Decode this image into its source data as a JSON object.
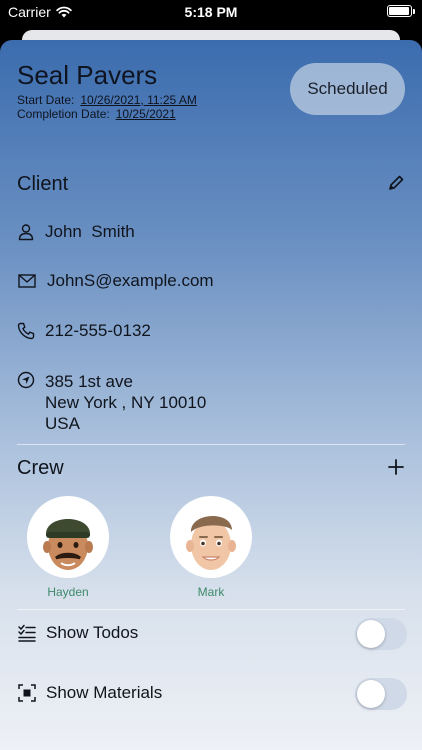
{
  "status_bar": {
    "carrier": "Carrier",
    "time": "5:18 PM"
  },
  "job": {
    "title": "Seal Pavers",
    "start_label": "Start Date:",
    "start_value": "10/26/2021, 11:25 AM",
    "completion_label": "Completion Date:",
    "completion_value": "10/25/2021",
    "status": "Scheduled"
  },
  "client": {
    "section_title": "Client",
    "name": "John  Smith",
    "email": "JohnS@example.com",
    "phone": "212-555-0132",
    "address_line1": "385 1st ave",
    "address_line2": "New York , NY 10010",
    "address_line3": "USA"
  },
  "crew": {
    "section_title": "Crew",
    "members": [
      {
        "name": "Hayden"
      },
      {
        "name": "Mark"
      }
    ]
  },
  "options": {
    "show_todos": {
      "label": "Show Todos",
      "on": false
    },
    "show_materials": {
      "label": "Show Materials",
      "on": false
    }
  },
  "colors": {
    "crew_name": "#3e8a6a",
    "sheet_top": "#3b6cae",
    "sheet_bottom": "#eef1f6"
  }
}
